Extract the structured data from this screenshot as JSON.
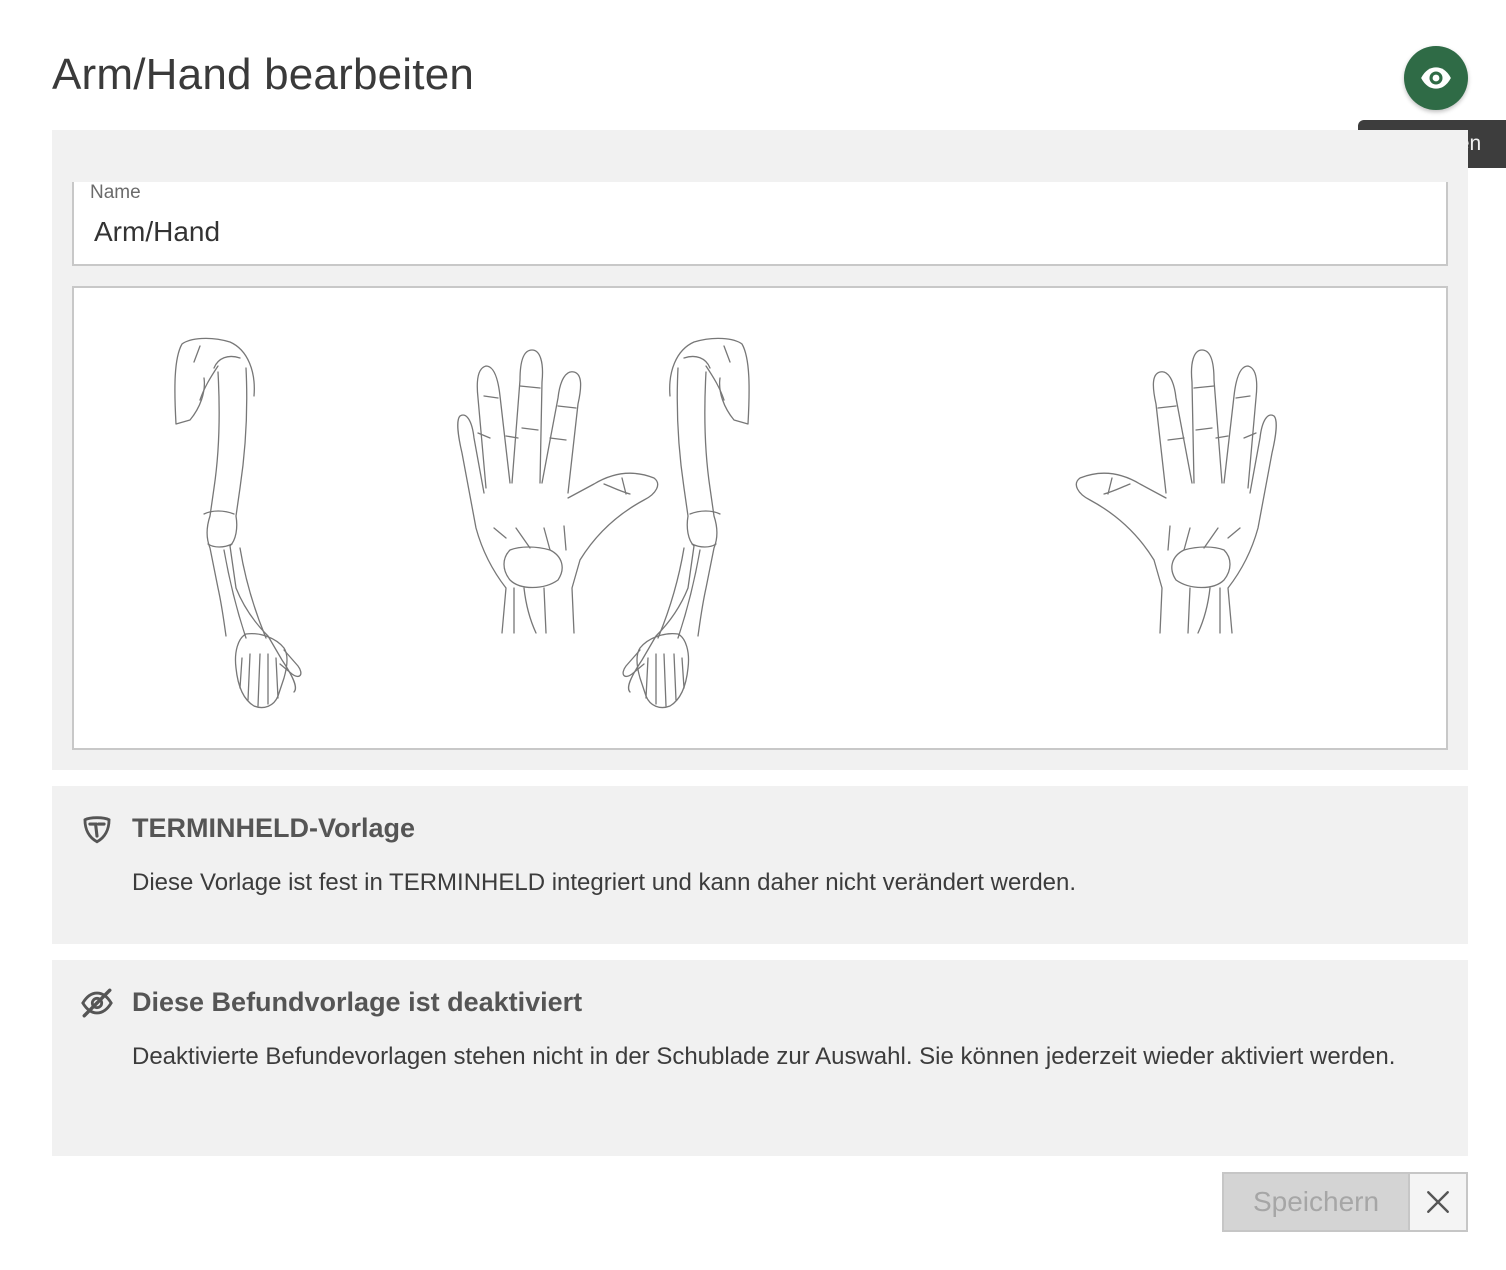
{
  "header": {
    "title": "Arm/Hand bearbeiten",
    "activate_tooltip": "Aktivieren"
  },
  "form": {
    "name_label": "Name",
    "name_value": "Arm/Hand"
  },
  "template_notice": {
    "title": "TERMINHELD-Vorlage",
    "text": "Diese Vorlage ist fest in TERMINHELD integriert und kann daher nicht verändert werden."
  },
  "deactivated_notice": {
    "title": "Diese Befundvorlage ist deaktiviert",
    "text": "Deaktivierte Befundevorlagen stehen nicht in der Schublade zur Auswahl. Sie können jederzeit wieder aktiviert werden."
  },
  "footer": {
    "save_label": "Speichern"
  },
  "colors": {
    "accent": "#2f6b46",
    "panel": "#f1f1f1",
    "tooltip": "#3d3d3d"
  },
  "icons": {
    "activate": "eye-icon",
    "template": "shield-icon",
    "deactivated": "eye-off-icon",
    "close": "close-icon"
  }
}
